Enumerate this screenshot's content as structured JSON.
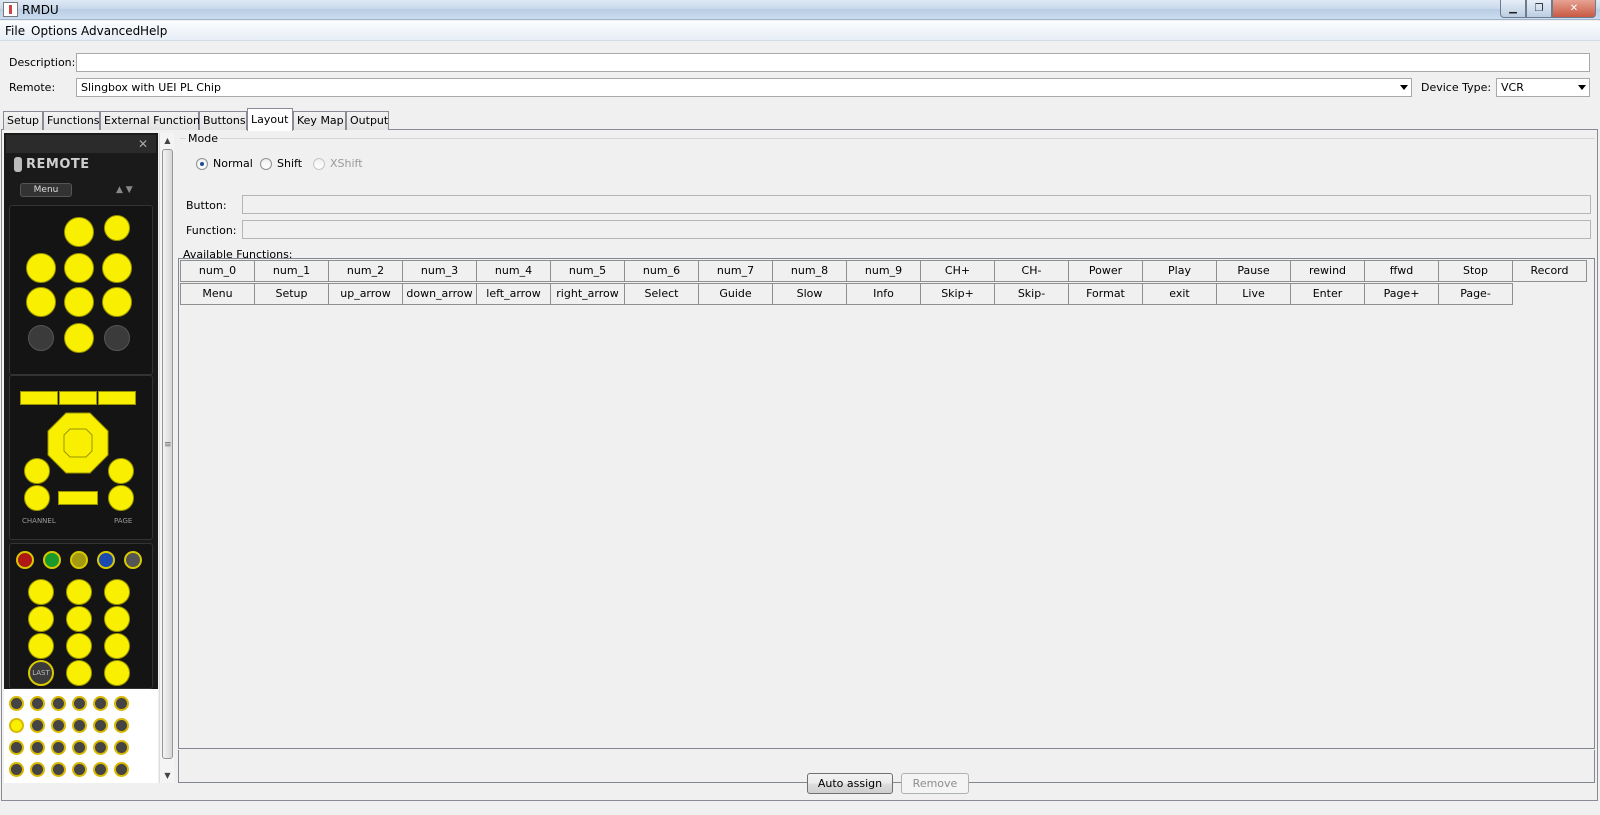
{
  "window": {
    "title": "RMDU"
  },
  "menu": [
    "File",
    "Options",
    "Advanced",
    "Help"
  ],
  "form": {
    "description_label": "Description:",
    "description_value": "",
    "remote_label": "Remote:",
    "remote_value": "Slingbox with UEI PL Chip",
    "device_type_label": "Device Type:",
    "device_type_value": "VCR"
  },
  "tabs": [
    "Setup",
    "Functions",
    "External Functions",
    "Buttons",
    "Layout",
    "Key Map",
    "Output"
  ],
  "active_tab": "Layout",
  "remote_image": {
    "logo": "REMOTE",
    "menu": "Menu",
    "channel": "CHANNEL",
    "page": "PAGE",
    "last": "LAST"
  },
  "mode": {
    "legend": "Mode",
    "options": [
      {
        "label": "Normal",
        "selected": true,
        "enabled": true
      },
      {
        "label": "Shift",
        "selected": false,
        "enabled": true
      },
      {
        "label": "XShift",
        "selected": false,
        "enabled": false
      }
    ]
  },
  "fields": {
    "button_label": "Button:",
    "button_value": "",
    "function_label": "Function:",
    "function_value": ""
  },
  "available_label": "Available Functions:",
  "functions": [
    [
      "num_0",
      "num_1",
      "num_2",
      "num_3",
      "num_4",
      "num_5",
      "num_6",
      "num_7",
      "num_8",
      "num_9",
      "CH+",
      "CH-",
      "Power",
      "Play",
      "Pause",
      "rewind",
      "ffwd",
      "Stop",
      "Record"
    ],
    [
      "Menu",
      "Setup",
      "up_arrow",
      "down_arrow",
      "left_arrow",
      "right_arrow",
      "Select",
      "Guide",
      "Slow",
      "Info",
      "Skip+",
      "Skip-",
      "Format",
      "exit",
      "Live",
      "Enter",
      "Page+",
      "Page-"
    ]
  ],
  "buttons": {
    "auto_assign": "Auto assign",
    "remove": "Remove"
  }
}
